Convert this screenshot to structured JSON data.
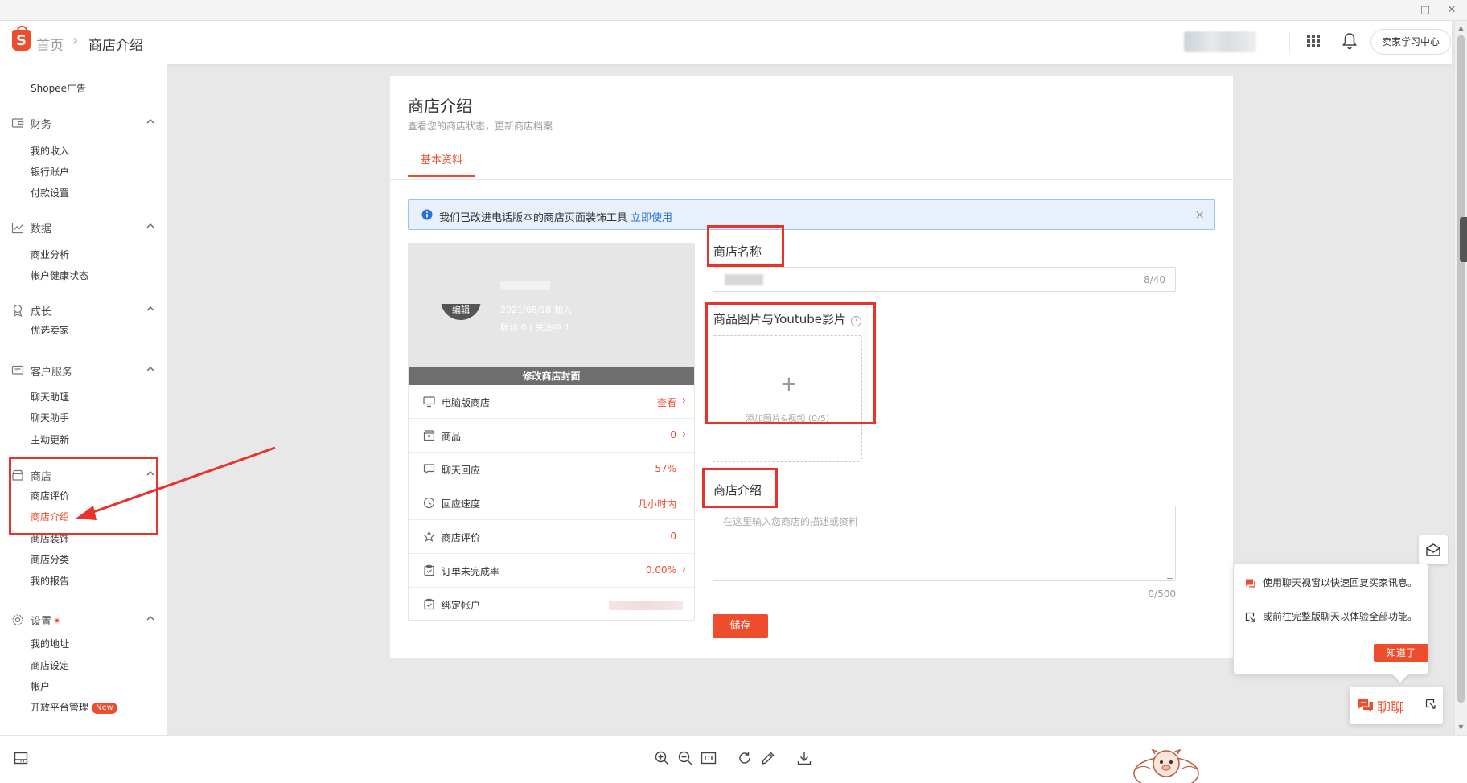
{
  "window": {
    "minimize": "–",
    "maximize": "□",
    "close": "✕"
  },
  "header": {
    "logo_letter": "S",
    "breadcrumb_home": "首页",
    "breadcrumb_sep": "›",
    "breadcrumb_current": "商店介绍",
    "learn_center": "卖家学习中心"
  },
  "sidebar": {
    "top_item": "Shopee广告",
    "groups": [
      {
        "title": "财务",
        "icon": "wallet-icon",
        "items": [
          "我的收入",
          "银行账户",
          "付款设置"
        ]
      },
      {
        "title": "数据",
        "icon": "chart-icon",
        "items": [
          "商业分析",
          "帐户健康状态"
        ]
      },
      {
        "title": "成长",
        "icon": "medal-icon",
        "items": [
          "优选卖家"
        ]
      },
      {
        "title": "客户服务",
        "icon": "chat-icon",
        "items": [
          "聊天助理",
          "聊天助手",
          "主动更新"
        ]
      },
      {
        "title": "商店",
        "icon": "shop-icon",
        "items": [
          "商店评价",
          "商店介绍",
          "商店装饰",
          "商店分类",
          "我的报告"
        ]
      },
      {
        "title": "设置",
        "icon": "gear-icon",
        "items": [
          "我的地址",
          "商店设定",
          "帐户",
          "开放平台管理"
        ]
      }
    ],
    "active_item": "商店介绍",
    "new_badge": "New"
  },
  "main": {
    "title": "商店介绍",
    "subtitle": "查看您的商店状态，更新商店档案",
    "tab": "基本资料",
    "notice_text": "我们已改进电话版本的商店页面装饰工具",
    "notice_link": "立即使用",
    "notice_close": "×",
    "shop": {
      "edit_label": "编辑",
      "joined": "2021/08/18 加入",
      "followers": "粉丝 0  |  关注中 1",
      "cover_button": "修改商店封面",
      "stats": [
        {
          "label": "电脑版商店",
          "value": "查看",
          "icon": "desktop-icon",
          "arrow": true
        },
        {
          "label": "商品",
          "value": "0",
          "icon": "box-icon",
          "arrow": true
        },
        {
          "label": "聊天回应",
          "value": "57%",
          "icon": "chat-bubble-icon",
          "arrow": false
        },
        {
          "label": "回应速度",
          "value": "几小时内",
          "icon": "clock-icon",
          "arrow": false
        },
        {
          "label": "商店评价",
          "value": "0",
          "icon": "star-icon",
          "arrow": false
        },
        {
          "label": "订单未完成率",
          "value": "0.00%",
          "icon": "clipboard-icon",
          "arrow": true
        },
        {
          "label": "绑定帐户",
          "value": "",
          "icon": "link-account-icon",
          "arrow": false
        }
      ]
    },
    "form": {
      "shop_name_label": "商店名称",
      "shop_name_count": "8/40",
      "media_label": "商品图片与Youtube影片",
      "media_help": "?",
      "upload_text": "添加图片&视频 (0/5)",
      "desc_label": "商店介绍",
      "desc_placeholder": "在这里输入您商店的描述或资料",
      "desc_count": "0/500",
      "save": "储存"
    }
  },
  "chat_popover": {
    "line1": "使用聊天视窗以快速回复买家讯息。",
    "line2": "或前往完整版聊天以体验全部功能。",
    "got_it": "知道了"
  },
  "chat_button": {
    "label": "聊聊"
  },
  "colors": {
    "brand": "#ee4d2d",
    "link": "#2673dd",
    "annotation": "#e8322a"
  }
}
